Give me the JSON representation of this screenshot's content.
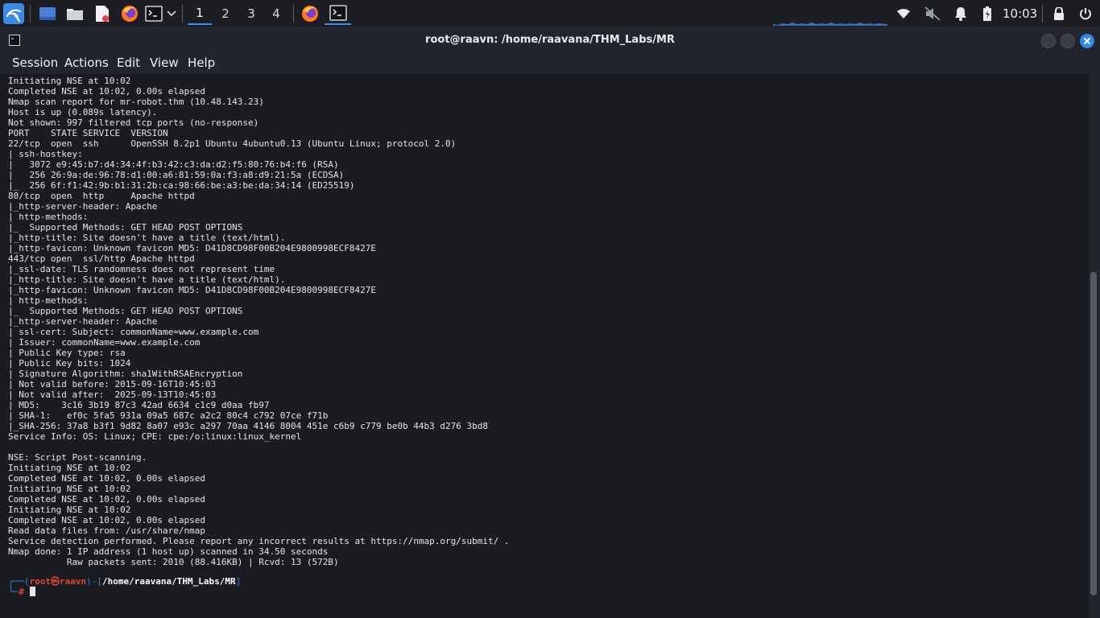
{
  "taskbar": {
    "workspaces": [
      "1",
      "2",
      "3",
      "4"
    ],
    "active_workspace": "1",
    "clock": "10:03",
    "icons": [
      "kali-menu-icon",
      "desktop-icon",
      "file-manager-icon",
      "text-editor-icon",
      "firefox-icon",
      "terminal-icon",
      "chevron-down-icon",
      "firefox-icon",
      "terminal-icon",
      "network-icon",
      "volume-muted-icon",
      "notification-bell-icon",
      "battery-icon",
      "lock-icon",
      "power-icon"
    ],
    "accent": "#3a8ee6"
  },
  "window": {
    "title": "root@raavn: /home/raavana/THM_Labs/MR",
    "menu": [
      "Session",
      "Actions",
      "Edit",
      "View",
      "Help"
    ]
  },
  "terminal": {
    "lines": [
      "Initiating NSE at 10:02",
      "Completed NSE at 10:02, 0.00s elapsed",
      "Nmap scan report for mr-robot.thm (10.48.143.23)",
      "Host is up (0.089s latency).",
      "Not shown: 997 filtered tcp ports (no-response)",
      "PORT    STATE SERVICE  VERSION",
      "22/tcp  open  ssh      OpenSSH 8.2p1 Ubuntu 4ubuntu0.13 (Ubuntu Linux; protocol 2.0)",
      "| ssh-hostkey: ",
      "|   3072 e9:45:b7:d4:34:4f:b3:42:c3:da:d2:f5:80:76:b4:f6 (RSA)",
      "|   256 26:9a:de:96:78:d1:00:a6:81:59:0a:f3:a8:d9:21:5a (ECDSA)",
      "|_  256 6f:f1:42:9b:b1:31:2b:ca:98:66:be:a3:be:da:34:14 (ED25519)",
      "80/tcp  open  http     Apache httpd",
      "|_http-server-header: Apache",
      "| http-methods: ",
      "|_  Supported Methods: GET HEAD POST OPTIONS",
      "|_http-title: Site doesn't have a title (text/html).",
      "|_http-favicon: Unknown favicon MD5: D41D8CD98F00B204E9800998ECF8427E",
      "443/tcp open  ssl/http Apache httpd",
      "|_ssl-date: TLS randomness does not represent time",
      "|_http-title: Site doesn't have a title (text/html).",
      "|_http-favicon: Unknown favicon MD5: D41D8CD98F00B204E9800998ECF8427E",
      "| http-methods: ",
      "|_  Supported Methods: GET HEAD POST OPTIONS",
      "|_http-server-header: Apache",
      "| ssl-cert: Subject: commonName=www.example.com",
      "| Issuer: commonName=www.example.com",
      "| Public Key type: rsa",
      "| Public Key bits: 1024",
      "| Signature Algorithm: sha1WithRSAEncryption",
      "| Not valid before: 2015-09-16T10:45:03",
      "| Not valid after:  2025-09-13T10:45:03",
      "| MD5:    3c16 3b19 87c3 42ad 6634 c1c9 d0aa fb97",
      "| SHA-1:   ef0c 5fa5 931a 09a5 687c a2c2 80c4 c792 07ce f71b",
      "|_SHA-256: 37a8 b3f1 9d82 8a07 e93c a297 70aa 4146 8004 451e c6b9 c779 be0b 44b3 d276 3bd8",
      "Service Info: OS: Linux; CPE: cpe:/o:linux:linux_kernel",
      "",
      "NSE: Script Post-scanning.",
      "Initiating NSE at 10:02",
      "Completed NSE at 10:02, 0.00s elapsed",
      "Initiating NSE at 10:02",
      "Completed NSE at 10:02, 0.00s elapsed",
      "Initiating NSE at 10:02",
      "Completed NSE at 10:02, 0.00s elapsed",
      "Read data files from: /usr/share/nmap",
      "Service detection performed. Please report any incorrect results at https://nmap.org/submit/ .",
      "Nmap done: 1 IP address (1 host up) scanned in 34.50 seconds",
      "           Raw packets sent: 2010 (88.416KB) | Rcvd: 13 (572B)"
    ],
    "prompt": {
      "user": "root",
      "host": "raavn",
      "path": "/home/raavana/THM_Labs/MR",
      "symbol": "#"
    }
  }
}
